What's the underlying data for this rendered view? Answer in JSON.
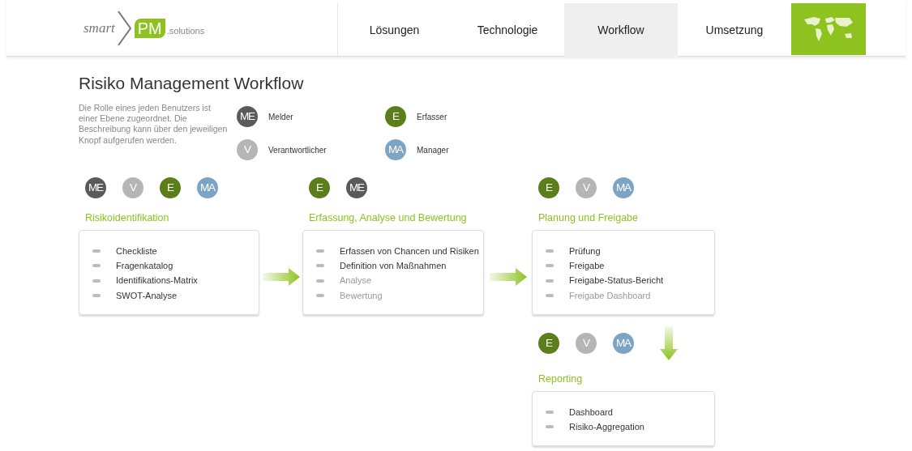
{
  "logo": {
    "word": "smart",
    "badge": "PM",
    "suffix": ".solutions"
  },
  "nav": [
    {
      "label": "Lösungen",
      "selected": false
    },
    {
      "label": "Technologie",
      "selected": false
    },
    {
      "label": "Workflow",
      "selected": true
    },
    {
      "label": "Umsetzung",
      "selected": false
    }
  ],
  "title": "Risiko Management Workflow",
  "description": "Die Rolle eines jeden Benutzers ist einer Ebene zugeordnet. Die Beschreibung kann über den jeweiligen Knopf aufgerufen werden.",
  "legend": [
    {
      "badge": "ME",
      "label": "Melder",
      "color": "#5a5a5a"
    },
    {
      "badge": "E",
      "label": "Erfasser",
      "color": "#5b7d1a"
    },
    {
      "badge": "V",
      "label": "Verantwortlicher",
      "color": "#b5b5b5"
    },
    {
      "badge": "MA",
      "label": "Manager",
      "color": "#7ba4c5"
    }
  ],
  "stages": [
    {
      "title": "Risikoidentifikation",
      "roles": [
        {
          "badge": "ME",
          "color": "#5a5a5a"
        },
        {
          "badge": "V",
          "color": "#b5b5b5"
        },
        {
          "badge": "E",
          "color": "#5b7d1a"
        },
        {
          "badge": "MA",
          "color": "#7ba4c5"
        }
      ],
      "items": [
        {
          "label": "Checkliste",
          "disabled": false
        },
        {
          "label": "Fragenkatalog",
          "disabled": false
        },
        {
          "label": "Identifikations-Matrix",
          "disabled": false
        },
        {
          "label": "SWOT-Analyse",
          "disabled": false
        }
      ]
    },
    {
      "title": "Erfassung, Analyse und Bewertung",
      "roles": [
        {
          "badge": "E",
          "color": "#5b7d1a"
        },
        {
          "badge": "ME",
          "color": "#5a5a5a"
        }
      ],
      "items": [
        {
          "label": "Erfassen von Chancen und Risiken",
          "disabled": false
        },
        {
          "label": "Definition von Maßnahmen",
          "disabled": false
        },
        {
          "label": "Analyse",
          "disabled": true
        },
        {
          "label": "Bewertung",
          "disabled": true
        }
      ]
    },
    {
      "title": "Planung und Freigabe",
      "roles": [
        {
          "badge": "E",
          "color": "#5b7d1a"
        },
        {
          "badge": "V",
          "color": "#b5b5b5"
        },
        {
          "badge": "MA",
          "color": "#7ba4c5"
        }
      ],
      "items": [
        {
          "label": "Prüfung",
          "disabled": false
        },
        {
          "label": "Freigabe",
          "disabled": false
        },
        {
          "label": "Freigabe-Status-Bericht",
          "disabled": false
        },
        {
          "label": "Freigabe Dashboard",
          "disabled": true
        }
      ]
    },
    {
      "title": "Reporting",
      "roles": [
        {
          "badge": "E",
          "color": "#5b7d1a"
        },
        {
          "badge": "V",
          "color": "#b5b5b5"
        },
        {
          "badge": "MA",
          "color": "#7ba4c5"
        }
      ],
      "items": [
        {
          "label": "Dashboard",
          "disabled": false
        },
        {
          "label": "Risiko-Aggregation",
          "disabled": false
        }
      ]
    }
  ]
}
